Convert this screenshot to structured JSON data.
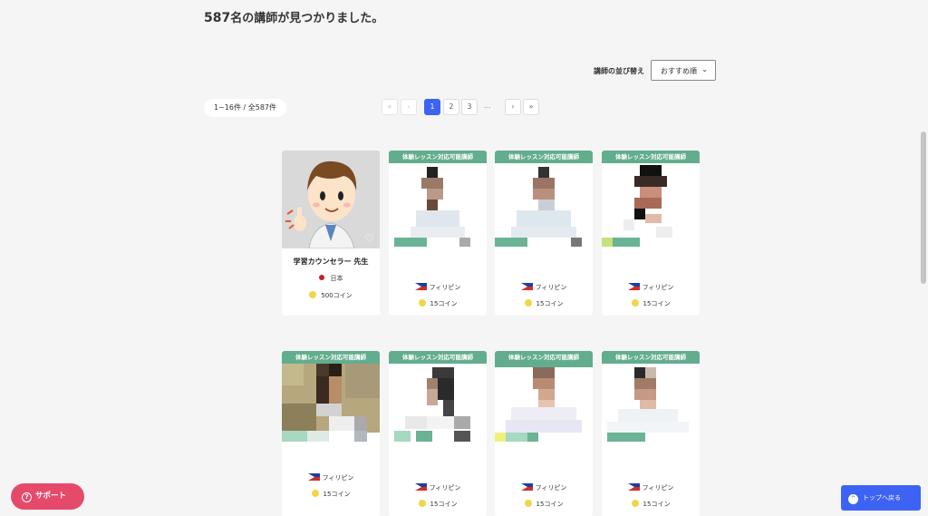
{
  "results": {
    "title_count": "587",
    "title_rest": "名の講師が見つかりました。"
  },
  "sort": {
    "label": "講師の並び替え",
    "selected": "おすすめ順"
  },
  "count_pill": "1~16件 / 全587件",
  "pagination": {
    "first": "«",
    "prev": "‹",
    "pages": [
      "1",
      "2",
      "3"
    ],
    "ellipsis": "…",
    "next": "›",
    "last": "»"
  },
  "trial_banner": "体験レッスン対応可能講師",
  "cards": [
    {
      "name": "学習カウンセラー 先生",
      "country": "日本",
      "coins": "500コイン"
    },
    {
      "country": "フィリピン",
      "coins": "15コイン"
    },
    {
      "country": "フィリピン",
      "coins": "15コイン"
    },
    {
      "country": "フィリピン",
      "coins": "15コイン"
    },
    {
      "country": "フィリピン",
      "coins": "15コイン"
    },
    {
      "country": "フィリピン",
      "coins": "15コイン"
    },
    {
      "country": "フィリピン",
      "coins": "15コイン"
    },
    {
      "country": "フィリピン",
      "coins": "15コイン"
    }
  ],
  "buttons": {
    "support": "サポート",
    "back_to_top": "トップへ戻る"
  },
  "colors": {
    "accent": "#3d63f5",
    "trial_green": "#62ad8d",
    "support_pink": "#e64a6b"
  }
}
